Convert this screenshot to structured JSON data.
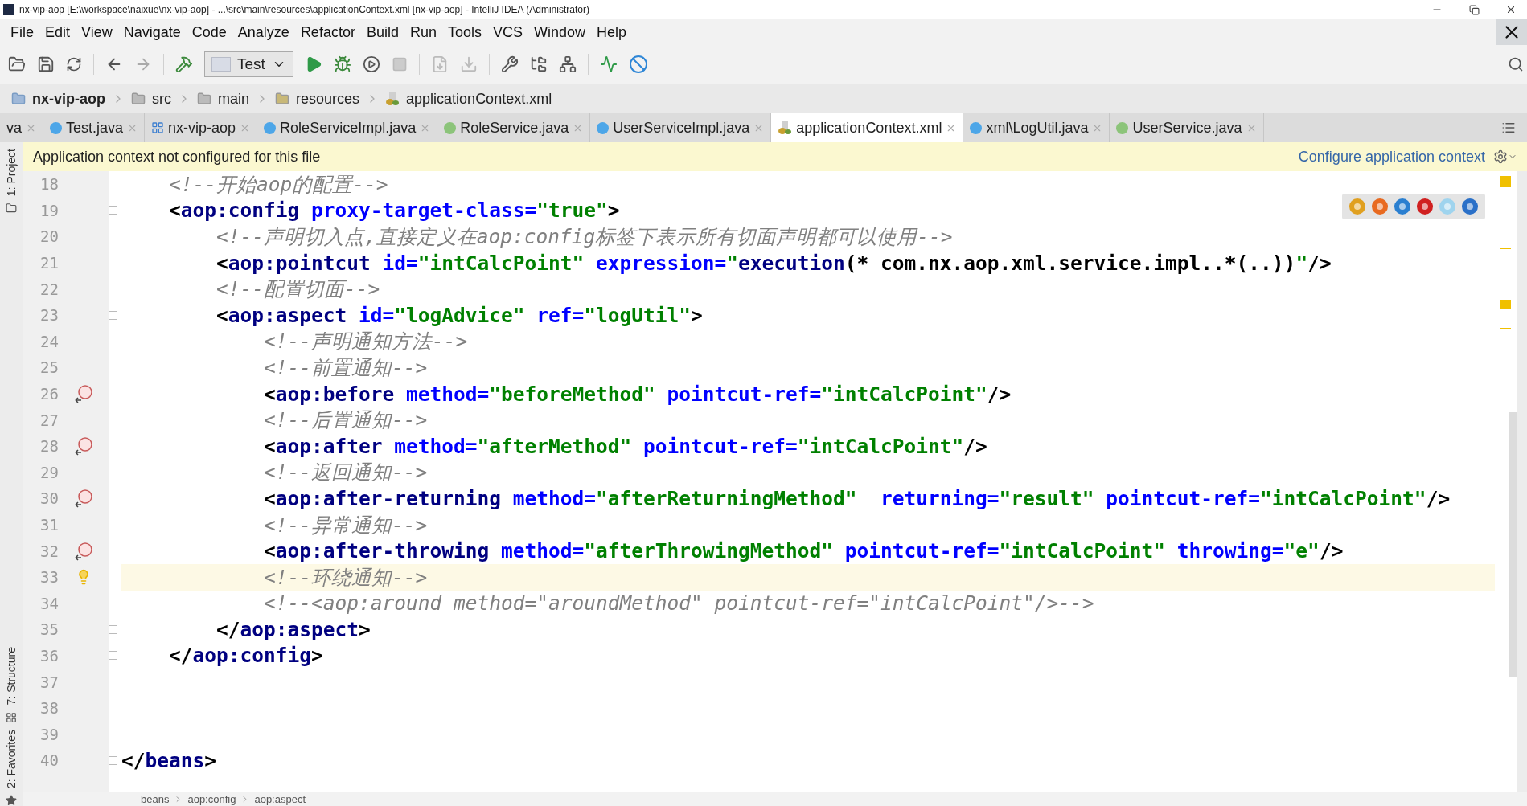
{
  "window": {
    "title": "nx-vip-aop [E:\\workspace\\naixue\\nx-vip-aop] - ...\\src\\main\\resources\\applicationContext.xml [nx-vip-aop] - IntelliJ IDEA (Administrator)"
  },
  "menu": [
    "File",
    "Edit",
    "View",
    "Navigate",
    "Code",
    "Analyze",
    "Refactor",
    "Build",
    "Run",
    "Tools",
    "VCS",
    "Window",
    "Help"
  ],
  "toolbar": {
    "run_config": "Test"
  },
  "breadcrumbs": [
    {
      "label": "nx-vip-aop",
      "kind": "module"
    },
    {
      "label": "src",
      "kind": "folder"
    },
    {
      "label": "main",
      "kind": "folder"
    },
    {
      "label": "resources",
      "kind": "resources"
    },
    {
      "label": "applicationContext.xml",
      "kind": "xml"
    }
  ],
  "tabs": [
    {
      "label": "va",
      "kind": "partial",
      "selected": false
    },
    {
      "label": "Test.java",
      "kind": "class",
      "selected": false
    },
    {
      "label": "nx-vip-aop",
      "kind": "module",
      "selected": false
    },
    {
      "label": "RoleServiceImpl.java",
      "kind": "class",
      "selected": false
    },
    {
      "label": "RoleService.java",
      "kind": "interface",
      "selected": false
    },
    {
      "label": "UserServiceImpl.java",
      "kind": "class",
      "selected": false
    },
    {
      "label": "applicationContext.xml",
      "kind": "xml",
      "selected": true
    },
    {
      "label": "xml\\LogUtil.java",
      "kind": "class",
      "selected": false
    },
    {
      "label": "UserService.java",
      "kind": "interface",
      "selected": false
    }
  ],
  "banner": {
    "message": "Application context not configured for this file",
    "link": "Configure application context"
  },
  "side_tools": [
    "1: Project",
    "7: Structure",
    "2: Favorites"
  ],
  "code": [
    {
      "number": "18",
      "kind": "plain",
      "fold": false,
      "current": false,
      "tokens": [
        {
          "kind": "comment",
          "text": "    <!--开始aop的配置-->"
        }
      ]
    },
    {
      "number": "19",
      "kind": "plain",
      "fold": true,
      "current": false,
      "tokens": [
        {
          "kind": "punct",
          "text": "    <"
        },
        {
          "kind": "tag",
          "text": "aop:config"
        },
        {
          "kind": "attr",
          "text": " proxy-target-class="
        },
        {
          "kind": "value",
          "text": "\"true\""
        },
        {
          "kind": "punct",
          "text": ">"
        }
      ]
    },
    {
      "number": "20",
      "kind": "plain",
      "fold": false,
      "current": false,
      "tokens": [
        {
          "kind": "comment",
          "text": "        <!--声明切入点,直接定义在aop:config标签下表示所有切面声明都可以使用-->"
        }
      ]
    },
    {
      "number": "21",
      "kind": "plain",
      "fold": false,
      "current": false,
      "tokens": [
        {
          "kind": "punct",
          "text": "        <"
        },
        {
          "kind": "tag",
          "text": "aop:pointcut"
        },
        {
          "kind": "attr",
          "text": " id="
        },
        {
          "kind": "value",
          "text": "\"intCalcPoint\""
        },
        {
          "kind": "attr",
          "text": " expression="
        },
        {
          "kind": "value",
          "text": "\""
        },
        {
          "kind": "keyword",
          "text": "execution"
        },
        {
          "kind": "punct",
          "text": "(* com.nx.aop.xml.service.impl..*(..))"
        },
        {
          "kind": "value",
          "text": "\""
        },
        {
          "kind": "punct",
          "text": "/>"
        }
      ]
    },
    {
      "number": "22",
      "kind": "plain",
      "fold": false,
      "current": false,
      "tokens": [
        {
          "kind": "comment",
          "text": "        <!--配置切面-->"
        }
      ]
    },
    {
      "number": "23",
      "kind": "plain",
      "fold": true,
      "current": false,
      "tokens": [
        {
          "kind": "punct",
          "text": "        <"
        },
        {
          "kind": "tag",
          "text": "aop:aspect"
        },
        {
          "kind": "attr",
          "text": " id="
        },
        {
          "kind": "value",
          "text": "\"logAdvice\""
        },
        {
          "kind": "attr",
          "text": " ref="
        },
        {
          "kind": "value",
          "text": "\"logUtil\""
        },
        {
          "kind": "punct",
          "text": ">"
        }
      ]
    },
    {
      "number": "24",
      "kind": "plain",
      "fold": false,
      "current": false,
      "tokens": [
        {
          "kind": "comment",
          "text": "            <!--声明通知方法-->"
        }
      ]
    },
    {
      "number": "25",
      "kind": "plain",
      "fold": false,
      "current": false,
      "tokens": [
        {
          "kind": "comment",
          "text": "            <!--前置通知-->"
        }
      ]
    },
    {
      "number": "26",
      "kind": "method",
      "fold": false,
      "current": false,
      "tokens": [
        {
          "kind": "punct",
          "text": "            <"
        },
        {
          "kind": "tag",
          "text": "aop:before"
        },
        {
          "kind": "attr",
          "text": " method="
        },
        {
          "kind": "value",
          "text": "\"beforeMethod\""
        },
        {
          "kind": "attr",
          "text": " pointcut-ref="
        },
        {
          "kind": "value",
          "text": "\"intCalcPoint\""
        },
        {
          "kind": "punct",
          "text": "/>"
        }
      ]
    },
    {
      "number": "27",
      "kind": "plain",
      "fold": false,
      "current": false,
      "tokens": [
        {
          "kind": "comment",
          "text": "            <!--后置通知-->"
        }
      ]
    },
    {
      "number": "28",
      "kind": "method",
      "fold": false,
      "current": false,
      "tokens": [
        {
          "kind": "punct",
          "text": "            <"
        },
        {
          "kind": "tag",
          "text": "aop:after"
        },
        {
          "kind": "attr",
          "text": " method="
        },
        {
          "kind": "value",
          "text": "\"afterMethod\""
        },
        {
          "kind": "attr",
          "text": " pointcut-ref="
        },
        {
          "kind": "value",
          "text": "\"intCalcPoint\""
        },
        {
          "kind": "punct",
          "text": "/>"
        }
      ]
    },
    {
      "number": "29",
      "kind": "plain",
      "fold": false,
      "current": false,
      "tokens": [
        {
          "kind": "comment",
          "text": "            <!--返回通知-->"
        }
      ]
    },
    {
      "number": "30",
      "kind": "method",
      "fold": false,
      "current": false,
      "tokens": [
        {
          "kind": "punct",
          "text": "            <"
        },
        {
          "kind": "tag",
          "text": "aop:after-returning"
        },
        {
          "kind": "attr",
          "text": " method="
        },
        {
          "kind": "value",
          "text": "\"afterReturningMethod\""
        },
        {
          "kind": "attr",
          "text": "  returning="
        },
        {
          "kind": "value",
          "text": "\"result\""
        },
        {
          "kind": "attr",
          "text": " pointcut-ref="
        },
        {
          "kind": "value",
          "text": "\"intCalcPoint\""
        },
        {
          "kind": "punct",
          "text": "/>"
        }
      ]
    },
    {
      "number": "31",
      "kind": "plain",
      "fold": false,
      "current": false,
      "tokens": [
        {
          "kind": "comment",
          "text": "            <!--异常通知-->"
        }
      ]
    },
    {
      "number": "32",
      "kind": "method",
      "fold": false,
      "current": false,
      "tokens": [
        {
          "kind": "punct",
          "text": "            <"
        },
        {
          "kind": "tag",
          "text": "aop:after-throwing"
        },
        {
          "kind": "attr",
          "text": " method="
        },
        {
          "kind": "value",
          "text": "\"afterThrowingMethod\""
        },
        {
          "kind": "attr",
          "text": " pointcut-ref="
        },
        {
          "kind": "value",
          "text": "\"intCalcPoint\""
        },
        {
          "kind": "attr",
          "text": " throwing="
        },
        {
          "kind": "value",
          "text": "\"e\""
        },
        {
          "kind": "punct",
          "text": "/>"
        }
      ]
    },
    {
      "number": "33",
      "kind": "bulb",
      "fold": false,
      "current": true,
      "tokens": [
        {
          "kind": "comment",
          "text": "            <!--环绕通知-->"
        }
      ]
    },
    {
      "number": "34",
      "kind": "plain",
      "fold": false,
      "current": false,
      "tokens": [
        {
          "kind": "comment",
          "text": "            <!--<aop:around method=\"aroundMethod\" pointcut-ref=\"intCalcPoint\"/>-->"
        }
      ]
    },
    {
      "number": "35",
      "kind": "plain",
      "fold": true,
      "current": false,
      "tokens": [
        {
          "kind": "punct",
          "text": "        </"
        },
        {
          "kind": "tag",
          "text": "aop:aspect"
        },
        {
          "kind": "punct",
          "text": ">"
        }
      ]
    },
    {
      "number": "36",
      "kind": "plain",
      "fold": true,
      "current": false,
      "tokens": [
        {
          "kind": "punct",
          "text": "    </"
        },
        {
          "kind": "tag",
          "text": "aop:config"
        },
        {
          "kind": "punct",
          "text": ">"
        }
      ]
    },
    {
      "number": "37",
      "kind": "plain",
      "fold": false,
      "current": false
    },
    {
      "number": "38",
      "kind": "plain",
      "fold": false,
      "current": false
    },
    {
      "number": "39",
      "kind": "plain",
      "fold": false,
      "current": false
    },
    {
      "number": "40",
      "kind": "plain",
      "fold": true,
      "current": false,
      "tokens": [
        {
          "kind": "punct",
          "text": "</"
        },
        {
          "kind": "tag",
          "text": "beans"
        },
        {
          "kind": "punct",
          "text": ">"
        }
      ]
    }
  ],
  "status_path": [
    "beans",
    "aop:config",
    "aop:aspect"
  ]
}
